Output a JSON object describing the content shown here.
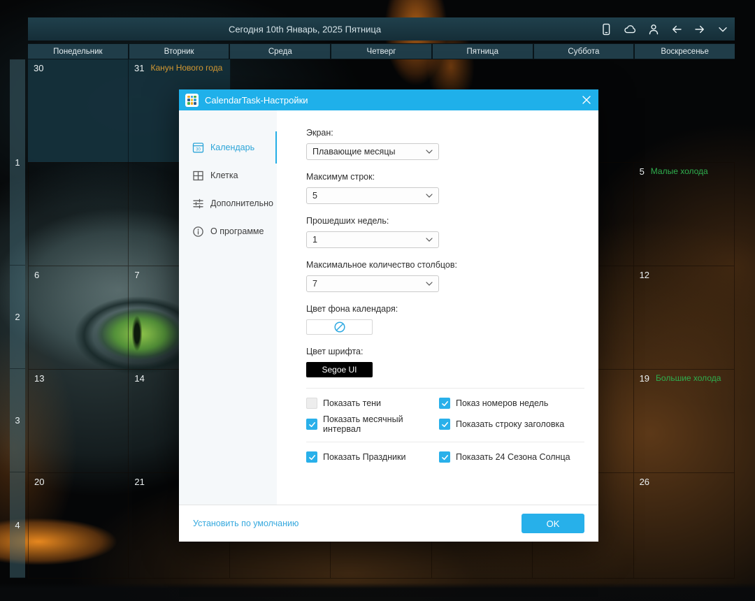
{
  "topbar": {
    "title": "Сегодня 10th Январь, 2025 Пятница"
  },
  "day_headers": [
    "Понедельник",
    "Вторник",
    "Среда",
    "Четверг",
    "Пятница",
    "Суббота",
    "Воскресенье"
  ],
  "week_numbers": [
    "1",
    "2",
    "3",
    "4"
  ],
  "calendar": {
    "past_cells": [
      {
        "date": "30",
        "holiday": ""
      },
      {
        "date": "31",
        "holiday": "Канун Нового года"
      }
    ],
    "cells": [
      {
        "date": "5",
        "note": "Малые холода"
      },
      {
        "date": "6",
        "note": ""
      },
      {
        "date": "7",
        "note": ""
      },
      {
        "date": "12",
        "note": ""
      },
      {
        "date": "13",
        "note": ""
      },
      {
        "date": "14",
        "note": ""
      },
      {
        "date": "19",
        "note": "Большие холода"
      },
      {
        "date": "20",
        "note": ""
      },
      {
        "date": "21",
        "note": ""
      },
      {
        "date": "26",
        "note": ""
      }
    ],
    "holiday_color": "#d69a33",
    "season_color": "#2fae4e"
  },
  "dialog": {
    "title": "CalendarTask-Настройки",
    "accent_color": "#29b0ea",
    "tabs": [
      {
        "label": "Календарь",
        "active": true
      },
      {
        "label": "Клетка",
        "active": false
      },
      {
        "label": "Дополнительно",
        "active": false
      },
      {
        "label": "О программе",
        "active": false
      }
    ],
    "fields": [
      {
        "label": "Экран:",
        "value": "Плавающие месяцы"
      },
      {
        "label": "Максимум строк:",
        "value": "5"
      },
      {
        "label": "Прошедших недель:",
        "value": "1"
      },
      {
        "label": "Максимальное количество столбцов:",
        "value": "7"
      }
    ],
    "bg_color": {
      "label": "Цвет фона календаря:"
    },
    "font_color": {
      "label": "Цвет шрифта:",
      "button": "Segoe UI"
    },
    "checkboxes": [
      {
        "label": "Показать тени",
        "checked": false
      },
      {
        "label": "Показ номеров недель",
        "checked": true
      },
      {
        "label": "Показать месячный интервал",
        "checked": true
      },
      {
        "label": "Показать строку заголовка",
        "checked": true
      },
      {
        "label": "Показать Праздники",
        "checked": true
      },
      {
        "label": "Показать 24 Сезона Солнца",
        "checked": true
      }
    ],
    "footer": {
      "default_link": "Установить по умолчанию",
      "ok_label": "OK"
    }
  }
}
